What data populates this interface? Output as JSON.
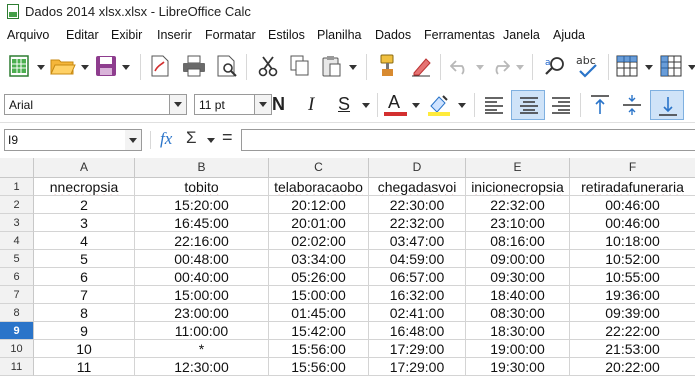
{
  "window": {
    "title": "Dados 2014 xlsx.xlsx - LibreOffice Calc"
  },
  "menu": [
    "Arquivo",
    "Editar",
    "Exibir",
    "Inserir",
    "Formatar",
    "Estilos",
    "Planilha",
    "Dados",
    "Ferramentas",
    "Janela",
    "Ajuda"
  ],
  "format_toolbar": {
    "font_name": "Arial",
    "font_size": "11 pt",
    "bold": "N",
    "italic": "I",
    "underline": "S",
    "font_color_letter": "A"
  },
  "formula_bar": {
    "cell_ref": "I9",
    "function_wizard": "fx",
    "sum": "Σ",
    "equals": "=",
    "content": ""
  },
  "colors": {
    "selected_row_header": "#2a74c9",
    "font_color_bar": "#d32f2f",
    "highlight_bar": "#ffeb3b",
    "spell_underline": "#d04040"
  },
  "sheet": {
    "columns": [
      "A",
      "B",
      "C",
      "D",
      "E",
      "F"
    ],
    "row_numbers": [
      "1",
      "2",
      "3",
      "4",
      "5",
      "6",
      "7",
      "8",
      "9",
      "10",
      "11"
    ],
    "selected_row": "9",
    "rows": [
      [
        "nnecropsia",
        "tobito",
        "telaboracaobo",
        "chegadasvoi",
        "inicionecropsia",
        "retiradafuneraria"
      ],
      [
        "2",
        "15:20:00",
        "20:12:00",
        "22:30:00",
        "22:32:00",
        "00:46:00"
      ],
      [
        "3",
        "16:45:00",
        "20:01:00",
        "22:32:00",
        "23:10:00",
        "00:46:00"
      ],
      [
        "4",
        "22:16:00",
        "02:02:00",
        "03:47:00",
        "08:16:00",
        "10:18:00"
      ],
      [
        "5",
        "00:48:00",
        "03:34:00",
        "04:59:00",
        "09:00:00",
        "10:52:00"
      ],
      [
        "6",
        "00:40:00",
        "05:26:00",
        "06:57:00",
        "09:30:00",
        "10:55:00"
      ],
      [
        "7",
        "15:00:00",
        "15:00:00",
        "16:32:00",
        "18:40:00",
        "19:36:00"
      ],
      [
        "8",
        "23:00:00",
        "01:45:00",
        "02:41:00",
        "08:30:00",
        "09:39:00"
      ],
      [
        "9",
        "11:00:00",
        "15:42:00",
        "16:48:00",
        "18:30:00",
        "22:22:00"
      ],
      [
        "10",
        "*",
        "15:56:00",
        "17:29:00",
        "19:00:00",
        "21:53:00"
      ],
      [
        "11",
        "12:30:00",
        "15:56:00",
        "17:29:00",
        "19:30:00",
        "20:22:00"
      ]
    ]
  }
}
